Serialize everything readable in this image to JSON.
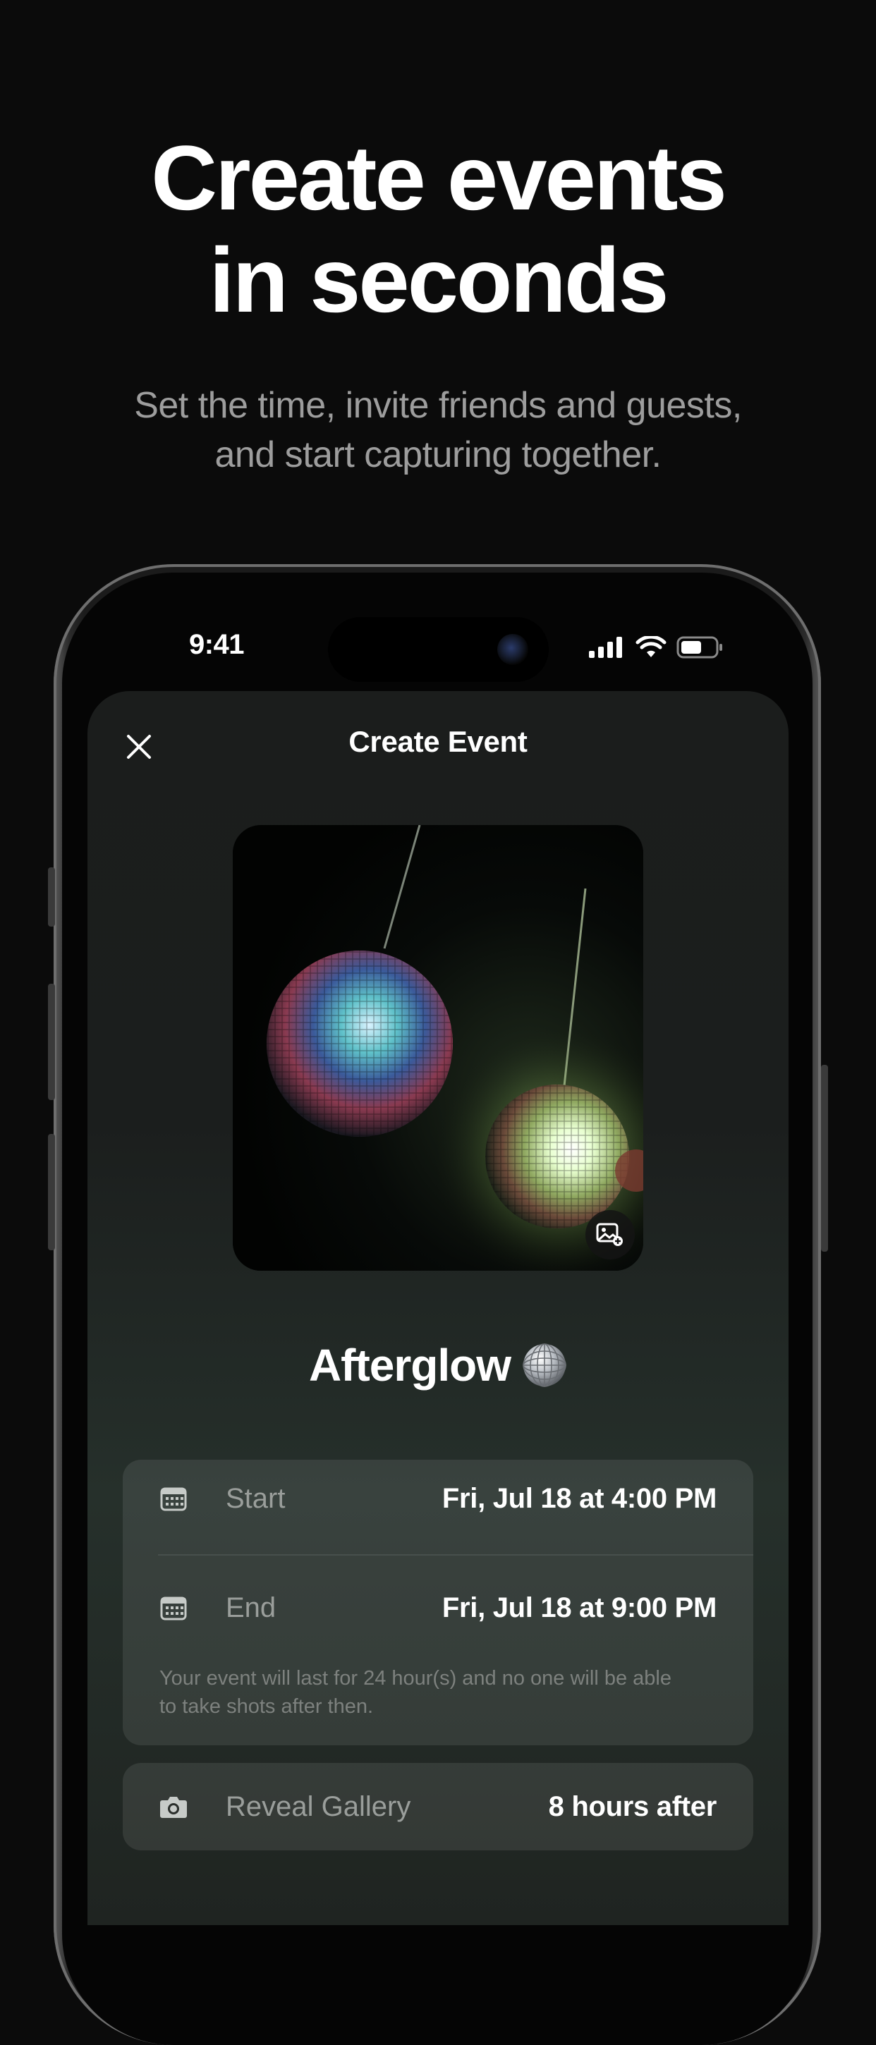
{
  "promo": {
    "headline_line1": "Create events",
    "headline_line2": "in seconds",
    "subhead_line1": "Set the time, invite friends and guests,",
    "subhead_line2": "and start capturing together."
  },
  "status_bar": {
    "time": "9:41"
  },
  "sheet": {
    "title": "Create Event",
    "event_name": "Afterglow",
    "event_emoji_icon": "disco-ball-icon",
    "start": {
      "label": "Start",
      "value": "Fri, Jul 18 at 4:00 PM"
    },
    "end": {
      "label": "End",
      "value": "Fri, Jul 18 at 9:00 PM"
    },
    "duration_note_line1": "Your event will last for 24 hour(s) and no one will be able",
    "duration_note_line2": "to take shots after then.",
    "reveal": {
      "label": "Reveal Gallery",
      "value": "8 hours after"
    }
  },
  "colors": {
    "background": "#0b0b0b",
    "subhead": "#9d9d9d",
    "sheet": "#1b1d1c",
    "muted_label": "#9a9e9b"
  }
}
